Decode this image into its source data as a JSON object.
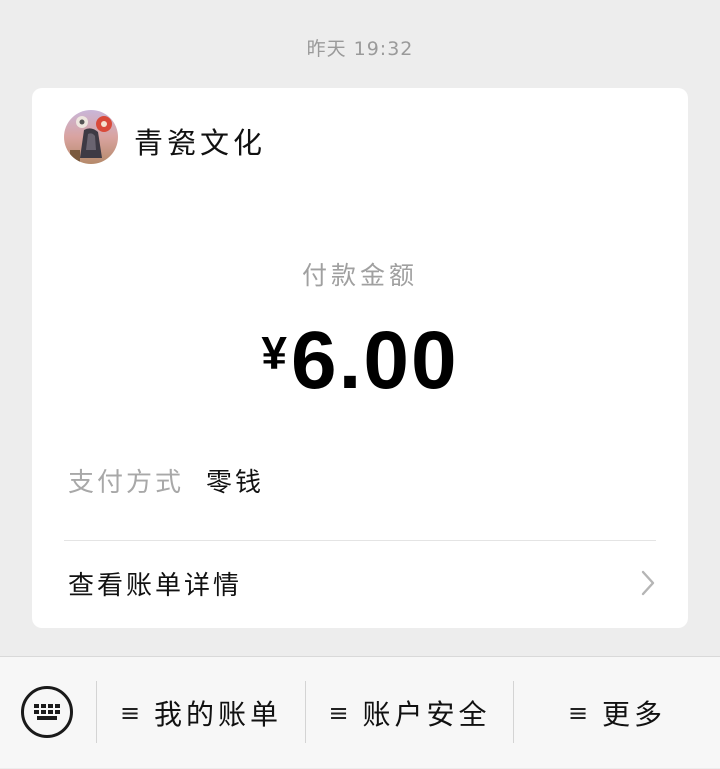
{
  "timestamp": "昨天 19:32",
  "card": {
    "merchant_name": "青瓷文化",
    "amount_label": "付款金额",
    "currency": "¥",
    "amount": "6.00",
    "pay_method_key": "支付方式",
    "pay_method_value": "零钱",
    "details_label": "查看账单详情"
  },
  "menu": {
    "items": [
      {
        "label": "我的账单"
      },
      {
        "label": "账户安全"
      },
      {
        "label": "更多"
      }
    ],
    "hamburger": "≡"
  },
  "icons": {
    "keyboard": "keyboard-icon",
    "chevron": "chevron-right-icon",
    "avatar": "merchant-avatar"
  }
}
